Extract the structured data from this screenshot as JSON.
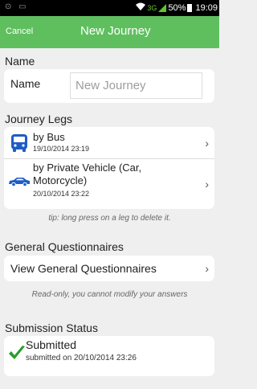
{
  "status_bar": {
    "left_icons": "⊙ ▭",
    "network": "3G",
    "battery": "50%",
    "time": "19:09",
    "network_color": "#5fc52f"
  },
  "app_bar": {
    "cancel_label": "Cancel",
    "title": "New Journey",
    "color": "#5fbf5f"
  },
  "name_section": {
    "heading": "Name",
    "field_label": "Name",
    "placeholder": "New Journey",
    "value": ""
  },
  "legs_section": {
    "heading": "Journey Legs",
    "legs": [
      {
        "icon": "bus-icon",
        "title": "by Bus",
        "date": "19/10/2014 23:19"
      },
      {
        "icon": "car-icon",
        "title_line1": "by Private Vehicle (Car,",
        "title_line2": "Motorcycle)",
        "date": "20/10/2014 23:22"
      }
    ],
    "tip": "tip: long press on a leg to delete it."
  },
  "questionnaires_section": {
    "heading": "General Questionnaires",
    "button_label": "View General Questionnaires",
    "note": "Read-only, you cannot modify your answers"
  },
  "submission_section": {
    "heading": "Submission Status",
    "status": "Submitted",
    "detail": "submitted on 20/10/2014 23:26",
    "check_color": "#2a9d2a"
  }
}
